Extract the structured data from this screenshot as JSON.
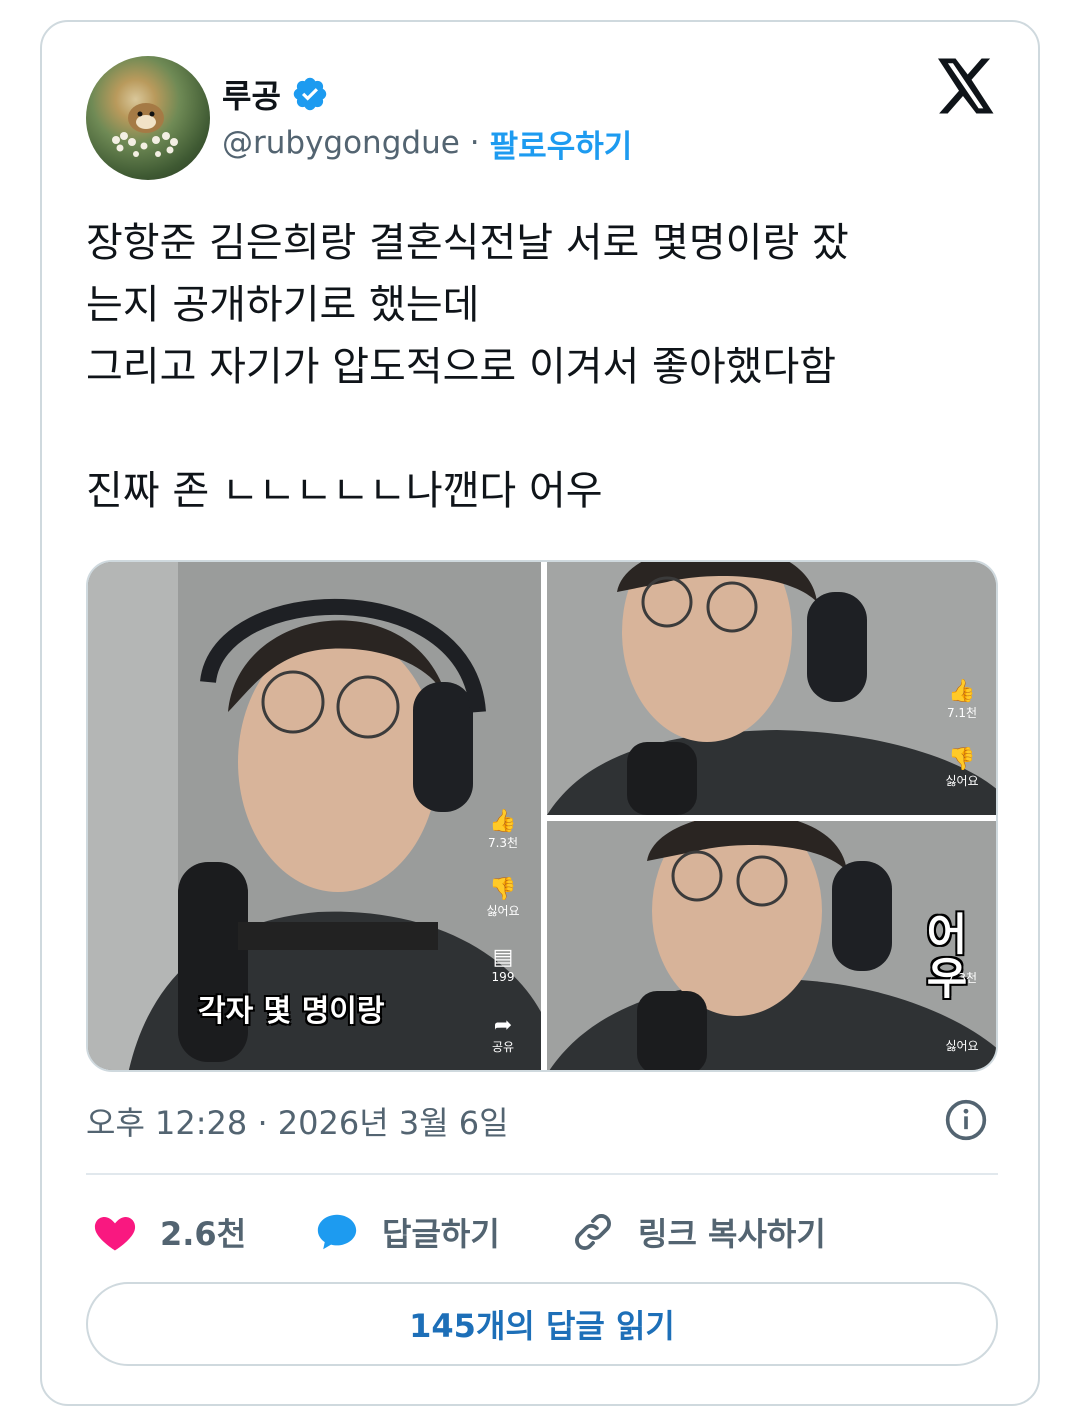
{
  "author": {
    "name": "루공",
    "handle": "@rubygongdue",
    "separator": "·",
    "follow_label": "팔로우하기"
  },
  "tweet": {
    "text": "장항준 김은희랑 결혼식전날 서로 몇명이랑 잤\n는지 공개하기로 했는데\n그리고 자기가 압도적으로 이겨서 좋아했다함\n\n진짜 존 ㄴㄴㄴㄴㄴ나깬다 어우"
  },
  "media": {
    "frame1": {
      "likes": "7.3천",
      "dislike": "싫어요",
      "comments": "199",
      "share": "공유",
      "caption": "각자 몇 명이랑"
    },
    "frame2": {
      "likes": "7.1천",
      "dislike": "싫어요"
    },
    "frame3": {
      "likes": "7.3천",
      "dislike": "싫어요",
      "overlay": "어우"
    }
  },
  "meta": {
    "timestamp": "오후 12:28 · 2026년 3월 6일"
  },
  "actions": {
    "likes": "2.6천",
    "reply_label": "답글하기",
    "copy_link_label": "링크 복사하기"
  },
  "read_replies_label": "145개의 답글 읽기",
  "colors": {
    "accent": "#1d9bf0",
    "heart": "#f91880",
    "muted": "#536471"
  }
}
